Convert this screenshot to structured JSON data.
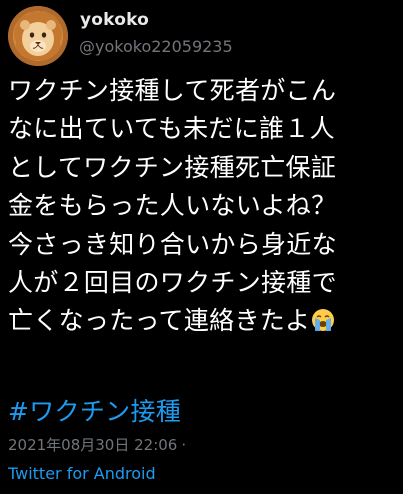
{
  "author": {
    "display_name": "yokoko",
    "handle": "@yokoko22059235",
    "avatar_icon": "lion-avatar-icon"
  },
  "tweet": {
    "lines": [
      "ワクチン接種して死者がこん",
      "なに出ていても未だに誰１人",
      "としてワクチン接種死亡保証",
      "金をもらった人いないよね？",
      "今さっき知り合いから身近な",
      "人が２回目のワクチン接種で",
      "亡くなったって連絡きたよ"
    ],
    "end_emoji": "loudly-crying-face-emoji",
    "hashtag": "#ワクチン接種"
  },
  "meta": {
    "timestamp": "2021年08月30日 22:06",
    "separator": "·",
    "source": "Twitter for Android"
  },
  "colors": {
    "background": "#000000",
    "text": "#ffffff",
    "secondary": "#71767b",
    "accent": "#1d9bf0"
  }
}
